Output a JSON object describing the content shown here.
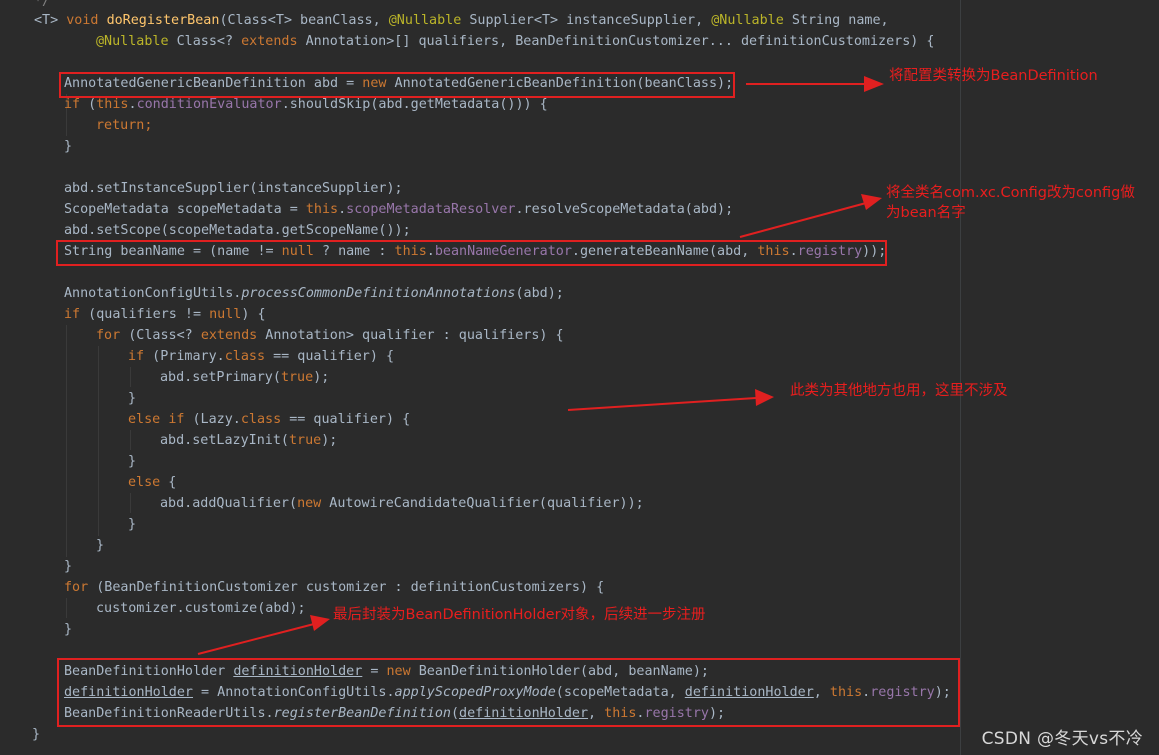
{
  "code": {
    "comment_tail": "*/",
    "l1": {
      "generic": "<T>",
      "void": "void",
      "method": "doRegisterBean",
      "p1": "(Class<",
      "t": "T",
      "p2": "> beanClass, ",
      "nullable1": "@Nullable",
      "p3": " Supplier<",
      "t2": "T",
      "p4": "> instanceSupplier, ",
      "nullable2": "@Nullable",
      "p5": " String name,"
    },
    "l2": {
      "nullable": "@Nullable",
      "p1": " Class<? ",
      "extends": "extends",
      "p2": " Annotation>[] qualifiers, BeanDefinitionCustomizer... definitionCustomizers) {"
    },
    "l3": {
      "p1": "AnnotatedGenericBeanDefinition abd = ",
      "new": "new",
      "p2": " AnnotatedGenericBeanDefinition(beanClass);"
    },
    "l4": {
      "if": "if",
      "p1": " (",
      "this": "this",
      "p2": ".",
      "field": "conditionEvaluator",
      "p3": ".shouldSkip(abd.getMetadata())) {"
    },
    "l5": {
      "return": "return",
      "semi": ";"
    },
    "l6": {
      "brace": "}"
    },
    "l7": {
      "text": "abd.setInstanceSupplier(instanceSupplier);"
    },
    "l8": {
      "p1": "ScopeMetadata scopeMetadata = ",
      "this": "this",
      "p2": ".",
      "field": "scopeMetadataResolver",
      "p3": ".resolveScopeMetadata(abd);"
    },
    "l9": {
      "text": "abd.setScope(scopeMetadata.getScopeName());"
    },
    "l10": {
      "p1": "String beanName = (name != ",
      "null": "null",
      "p2": " ? name : ",
      "this1": "this",
      "p3": ".",
      "field1": "beanNameGenerator",
      "p4": ".generateBeanName(abd, ",
      "this2": "this",
      "p5": ".",
      "field2": "registry",
      "p6": "));"
    },
    "l11": {
      "p1": "AnnotationConfigUtils.",
      "method": "processCommonDefinitionAnnotations",
      "p2": "(abd);"
    },
    "l12": {
      "if": "if",
      "p1": " (qualifiers != ",
      "null": "null",
      "p2": ") {"
    },
    "l13": {
      "for": "for",
      "p1": " (Class<? ",
      "extends": "extends",
      "p2": " Annotation> qualifier : qualifiers) {"
    },
    "l14": {
      "if": "if",
      "p1": " (Primary.",
      "class": "class",
      "p2": " == qualifier) {"
    },
    "l15": {
      "p1": "abd.setPrimary(",
      "true": "true",
      "p2": ");"
    },
    "l16": {
      "brace": "}"
    },
    "l17": {
      "else": "else",
      "sp": " ",
      "if": "if",
      "p1": " (Lazy.",
      "class": "class",
      "p2": " == qualifier) {"
    },
    "l18": {
      "p1": "abd.setLazyInit(",
      "true": "true",
      "p2": ");"
    },
    "l19": {
      "brace": "}"
    },
    "l20": {
      "else": "else",
      "p1": " {"
    },
    "l21": {
      "p1": "abd.addQualifier(",
      "new": "new",
      "p2": " AutowireCandidateQualifier(qualifier));"
    },
    "l22": {
      "brace": "}"
    },
    "l23": {
      "brace": "}"
    },
    "l24": {
      "brace": "}"
    },
    "l25": {
      "for": "for",
      "p1": " (BeanDefinitionCustomizer customizer : definitionCustomizers) {"
    },
    "l26": {
      "text": "customizer.customize(abd);"
    },
    "l27": {
      "brace": "}"
    },
    "l28": {
      "p1": "BeanDefinitionHolder ",
      "var": "definitionHolder",
      "p2": " = ",
      "new": "new",
      "p3": " BeanDefinitionHolder(abd, beanName);"
    },
    "l29": {
      "var1": "definitionHolder",
      "p1": " = AnnotationConfigUtils.",
      "method": "applyScopedProxyMode",
      "p2": "(scopeMetadata, ",
      "var2": "definitionHolder",
      "p3": ", ",
      "this": "this",
      "p4": ".",
      "field": "registry",
      "p5": ");"
    },
    "l30": {
      "p1": "BeanDefinitionReaderUtils.",
      "method": "registerBeanDefinition",
      "p2": "(",
      "var": "definitionHolder",
      "p3": ", ",
      "this": "this",
      "p4": ".",
      "field": "registry",
      "p5": ");"
    },
    "l31": {
      "brace": "}"
    }
  },
  "annotations": {
    "note1": "将配置类转换为BeanDefinition",
    "note2_line1": "将全类名com.xc.Config改为config做",
    "note2_line2": "为bean名字",
    "note3": "此类为其他地方也用，这里不涉及",
    "note4": "最后封装为BeanDefinitionHolder对象，后续进一步注册"
  },
  "watermark": "CSDN @冬天vs不冷",
  "colors": {
    "background": "#2b2b2b",
    "default_text": "#a9b7c6",
    "keyword": "#cc7832",
    "annotation": "#bbb529",
    "method_declaration": "#ffc66d",
    "field": "#9876aa",
    "annotation_red": "#e02020"
  }
}
